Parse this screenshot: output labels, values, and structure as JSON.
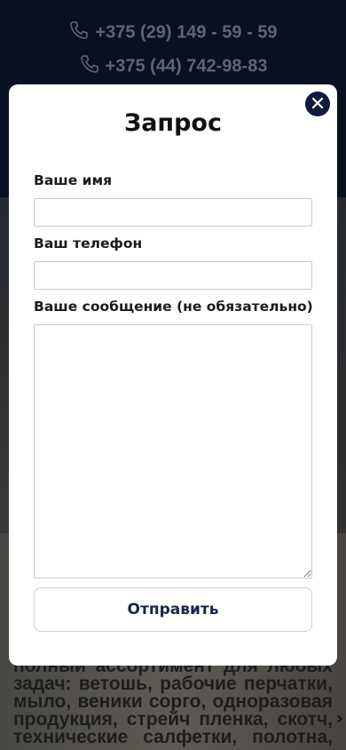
{
  "background": {
    "phones": [
      "+375 (29) 149 - 59 - 59",
      "+375 (44) 742-98-83"
    ],
    "text_lines": [
      "полный ассортимент для любых",
      "задач: ветошь, рабочие перчатки,",
      "мыло, веники сорго, одноразовая",
      "продукция, стрейч пленка, скотч,",
      "технические салфетки, полотна,"
    ],
    "phone_icon": "phone-icon",
    "arrow_icon": "chevron-right-icon"
  },
  "modal": {
    "title": "Запрос",
    "close_icon": "close-icon",
    "fields": {
      "name_label": "Ваше имя",
      "name_value": "",
      "phone_label": "Ваш телефон",
      "phone_value": "",
      "message_label": "Ваше сообщение (не обязательно)",
      "message_value": ""
    },
    "submit_label": "Отправить"
  },
  "colors": {
    "header_bg": "#081022",
    "accent_dark_navy": "#0f1b3d",
    "button_text": "#18254a"
  }
}
